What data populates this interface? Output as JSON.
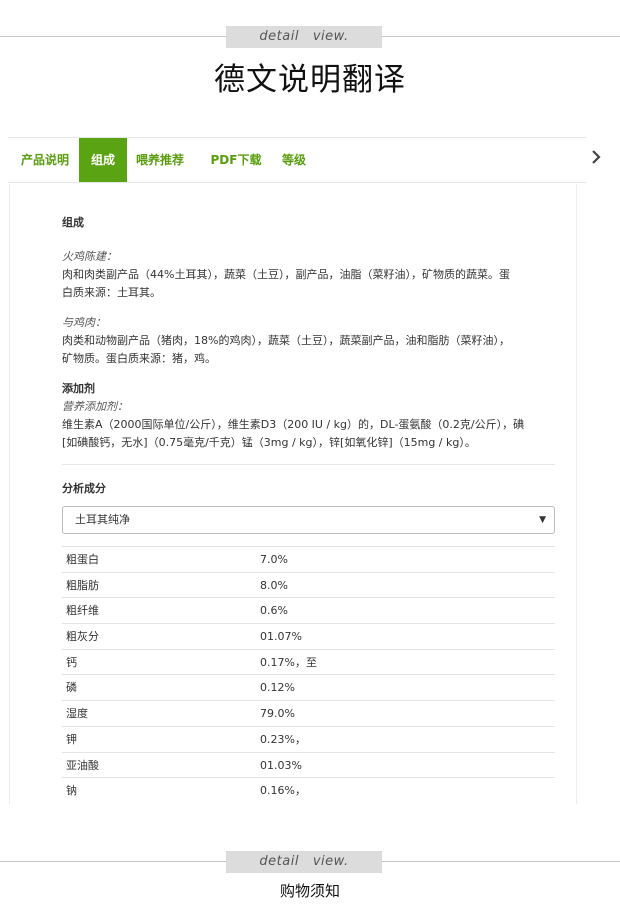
{
  "banner": {
    "label": "detail   view."
  },
  "title": "德文说明翻译",
  "tabs": [
    {
      "label": "产品说明",
      "active": false
    },
    {
      "label": "组成",
      "active": true
    },
    {
      "label": "喂养推荐",
      "active": false
    },
    {
      "label": "PDF下载",
      "active": false
    },
    {
      "label": "等级",
      "active": false
    }
  ],
  "composition": {
    "heading": "组成",
    "turkey_label": "火鸡陈建：",
    "turkey_line1": "肉和肉类副产品（44%土耳其），蔬菜（土豆），副产品，油脂（菜籽油），矿物质的蔬菜。蛋",
    "turkey_line2": "白质来源：土耳其。",
    "chicken_label": "与鸡肉：",
    "chicken_line1": "肉类和动物副产品（猪肉，18%的鸡肉），蔬菜（土豆），蔬菜副产品，油和脂肪（菜籽油），",
    "chicken_line2": "矿物质。蛋白质来源：猪，鸡。",
    "additives_heading": "添加剂",
    "additives_label": "营养添加剂：",
    "additives_line1": "维生素A（2000国际单位/公斤），维生素D3（200 IU / kg）的，DL-蛋氨酸（0.2克/公斤），碘",
    "additives_line2": "[如碘酸钙，无水]（0.75毫克/千克）锰（3mg / kg），锌[如氧化锌]（15mg / kg）。"
  },
  "analysis": {
    "heading": "分析成分",
    "select_value": "土耳其纯净",
    "rows": [
      {
        "name": "粗蛋白",
        "value": "7.0%"
      },
      {
        "name": "粗脂肪",
        "value": "8.0%"
      },
      {
        "name": "粗纤维",
        "value": "0.6%"
      },
      {
        "name": "粗灰分",
        "value": "01.07%"
      },
      {
        "name": "钙",
        "value": "0.17%，至"
      },
      {
        "name": "磷",
        "value": "0.12%"
      },
      {
        "name": "湿度",
        "value": "79.0%"
      },
      {
        "name": "钾",
        "value": "0.23%，"
      },
      {
        "name": "亚油酸",
        "value": "01.03%"
      },
      {
        "name": "钠",
        "value": "0.16%，"
      }
    ]
  },
  "footer": {
    "title": "购物须知"
  },
  "colors": {
    "accent": "#5aa312",
    "tab_text": "#5a9e0f"
  },
  "icons": {
    "scroll": "chevron-right-icon",
    "caret": "caret-down-icon"
  }
}
